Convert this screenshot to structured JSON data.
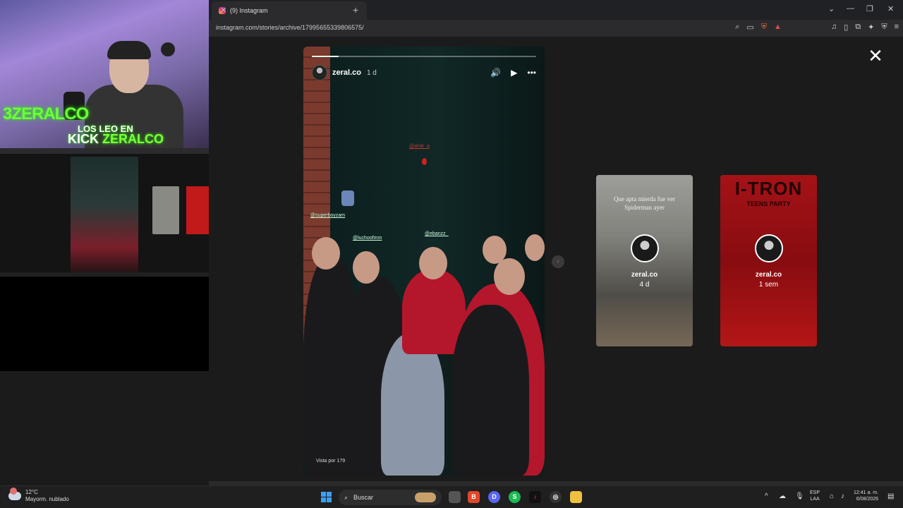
{
  "browser": {
    "tab_title": "(9) Instagram",
    "tab_close": "✕",
    "new_tab": "+",
    "url": "instagram.com/stories/archive/17995655339806575/",
    "window_controls": [
      "⌄",
      "—",
      "❐",
      "✕"
    ],
    "url_icons": [
      "zoom-icon",
      "cast-icon",
      "brave-shield-icon",
      "rewards-icon"
    ],
    "toolbar_icons": [
      "♫",
      "▯",
      "⧉",
      "✦",
      "⛨",
      "≡"
    ]
  },
  "stream_overlay": {
    "logo_text": "3ZERALCO",
    "banner_line1": "LOS LEO EN",
    "banner_kick": "KICK",
    "banner_name": "ZERALCO"
  },
  "story": {
    "username": "zeral.co",
    "time": "1 d",
    "progress": 0.12,
    "tags": [
      "@superboyzam",
      "@luchoofmm",
      "@ebanzz_",
      "@ahdr_a"
    ],
    "seen_by": "Vista por 179",
    "controls": [
      "🔊",
      "▶",
      "•••"
    ]
  },
  "close_label": "✕",
  "next_label": "›",
  "side_stories": [
    {
      "caption": "Que apta mierda fue ver Spiderman ayer",
      "name": "zeral.co",
      "time": "4 d"
    },
    {
      "title": "I-TRON",
      "subtitle": "TEENS PARTY",
      "name": "zeral.co",
      "time": "1 sem"
    }
  ],
  "taskbar": {
    "temperature": "12°C",
    "weather": "Mayorm. nublado",
    "search_placeholder": "Buscar",
    "lang_line1": "ESP",
    "lang_line2": "LAA",
    "time": "12:41 a. m.",
    "date": "6/08/2026",
    "chevron": "^"
  }
}
